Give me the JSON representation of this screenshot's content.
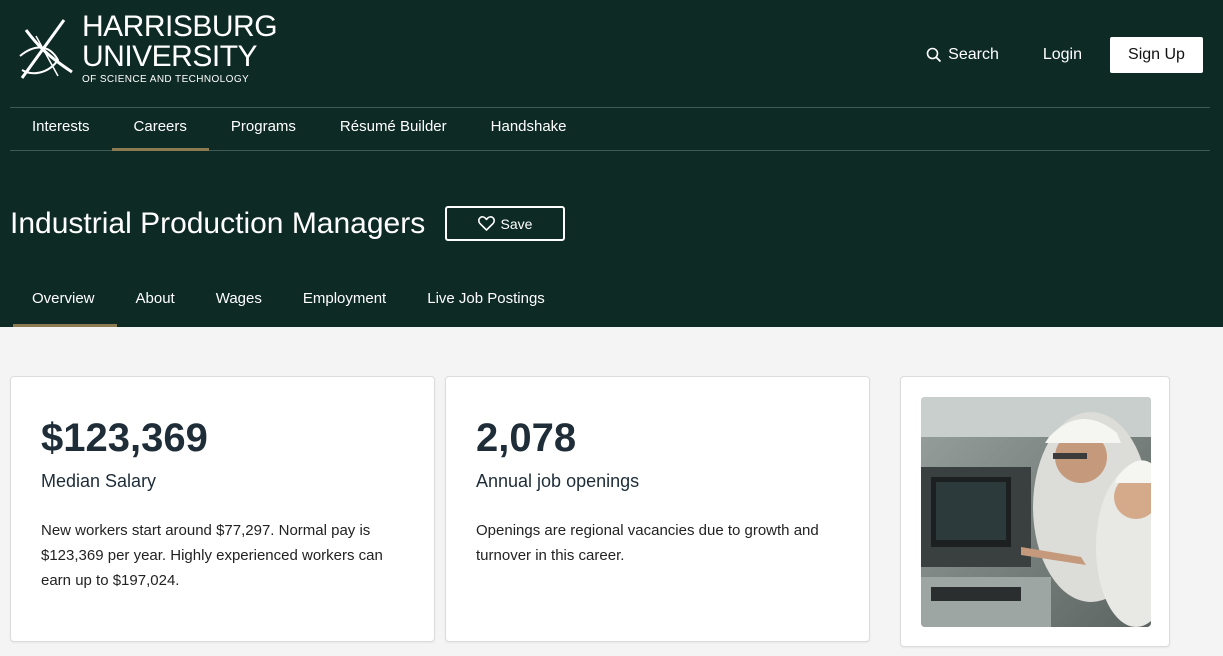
{
  "logo": {
    "line1": "HARRISBURG",
    "line2": "UNIVERSITY",
    "line3": "OF SCIENCE AND TECHNOLOGY"
  },
  "header": {
    "search_label": "Search",
    "login_label": "Login",
    "signup_label": "Sign Up"
  },
  "main_nav": {
    "items": [
      {
        "label": "Interests"
      },
      {
        "label": "Careers"
      },
      {
        "label": "Programs"
      },
      {
        "label": "Résumé Builder"
      },
      {
        "label": "Handshake"
      }
    ],
    "active": "Careers"
  },
  "page": {
    "title": "Industrial Production Managers",
    "save_label": "Save"
  },
  "sub_tabs": {
    "items": [
      {
        "label": "Overview"
      },
      {
        "label": "About"
      },
      {
        "label": "Wages"
      },
      {
        "label": "Employment"
      },
      {
        "label": "Live Job Postings"
      }
    ],
    "active": "Overview"
  },
  "cards": {
    "salary": {
      "value": "$123,369",
      "label": "Median Salary",
      "description": "New workers start around $77,297. Normal pay is $123,369 per year. Highly experienced workers can earn up to $197,024."
    },
    "jobs": {
      "value": "2,078",
      "label": "Annual job openings",
      "description": "Openings are regional vacancies due to growth and turnover in this career."
    }
  },
  "colors": {
    "header_bg": "#0e2a24",
    "accent": "#8b7a52",
    "page_bg": "#f4f4f4"
  }
}
